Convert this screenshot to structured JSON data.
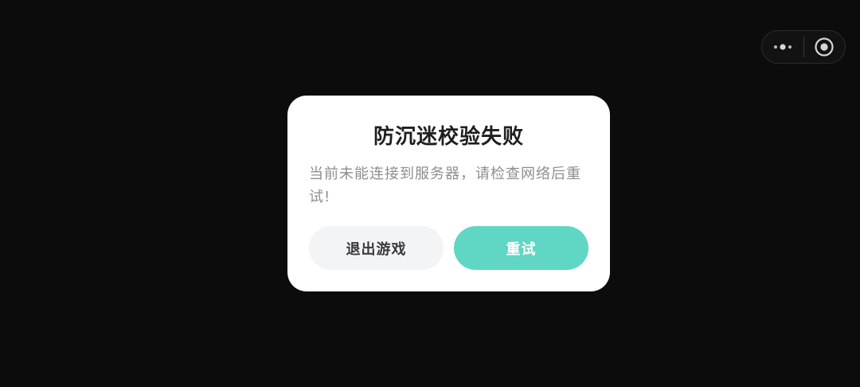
{
  "capsule": {
    "more_icon": "more-dots-icon",
    "close_icon": "target-close-icon"
  },
  "dialog": {
    "title": "防沉迷校验失败",
    "message": "当前未能连接到服务器，请检查网络后重试!",
    "exit_label": "退出游戏",
    "retry_label": "重试"
  },
  "colors": {
    "background": "#0d0c0d",
    "dialog": "#ffffff",
    "retry_button": "#5fd7c4",
    "exit_button": "#f3f4f6",
    "message_text": "#8e8e8e"
  }
}
